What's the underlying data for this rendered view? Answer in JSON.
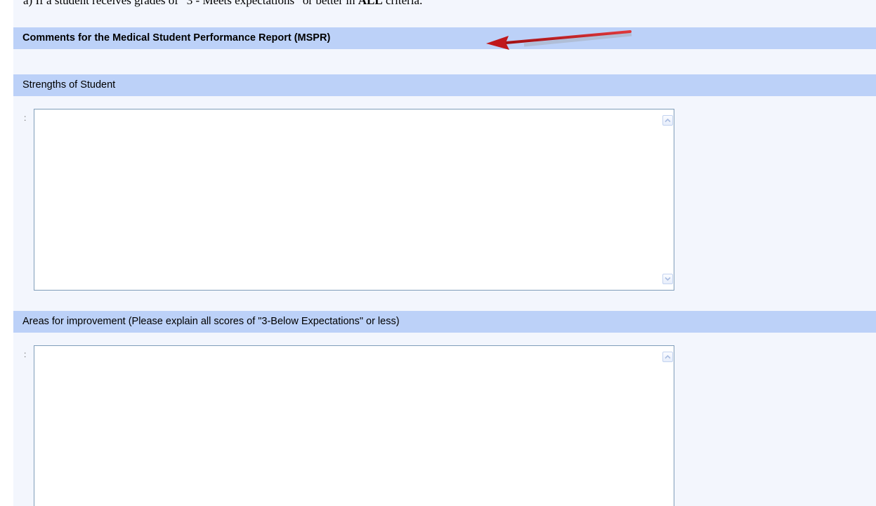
{
  "intro": {
    "prefix": "a) If a student receives grades of “3 - Meets expectations” or better in ",
    "emphasis": "ALL",
    "suffix": " criteria."
  },
  "sections": {
    "mspr_header": "Comments for the Medical Student Performance Report (MSPR)",
    "strengths_header": "Strengths of Student",
    "strengths_colon": ":",
    "strengths_value": "",
    "areas_header": "Areas for improvement (Please explain all scores of \"3-Below Expectations\" or less)",
    "areas_colon": ":",
    "areas_value": ""
  },
  "colors": {
    "header_background": "#bcd1f8",
    "page_background": "#f3f6fd",
    "annotation_arrow": "#c0171b"
  },
  "icons": {
    "annotation": "red-arrow-icon",
    "scroll_up": "chevron-up-icon",
    "scroll_down": "chevron-down-icon"
  }
}
